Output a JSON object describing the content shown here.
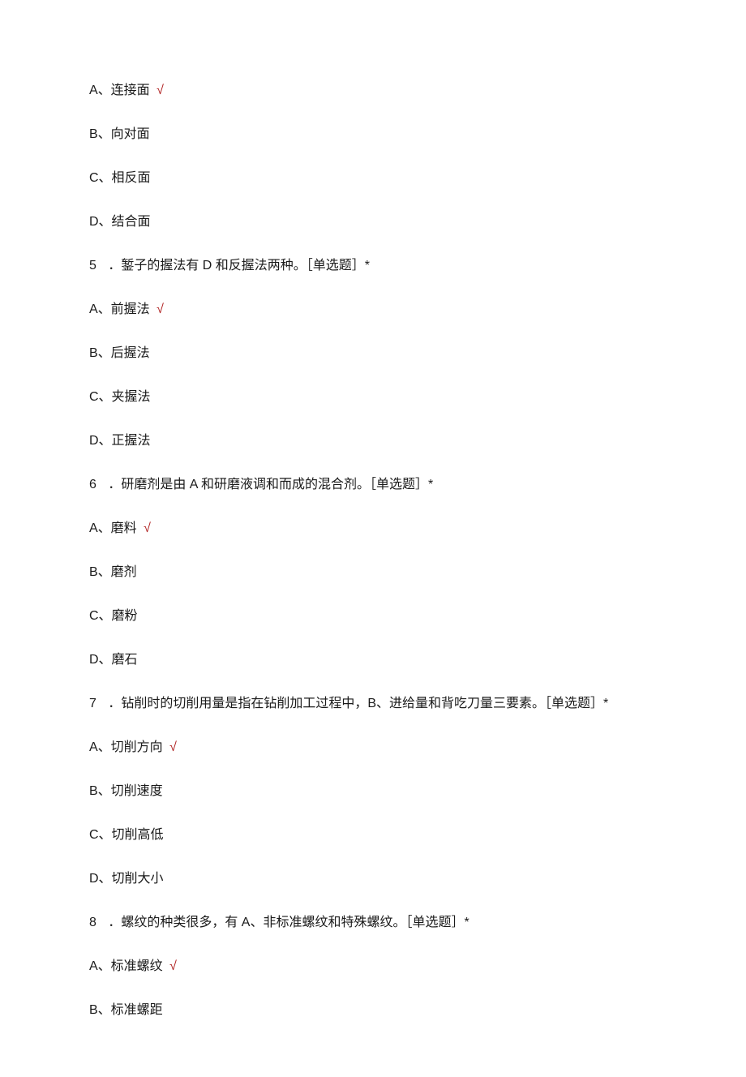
{
  "q4": {
    "a": {
      "label": "A、连接面",
      "correct": true
    },
    "b": {
      "label": "B、向对面"
    },
    "c": {
      "label": "C、相反面"
    },
    "d": {
      "label": "D、结合面"
    }
  },
  "q5": {
    "num": "5",
    "text": "．錾子的握法有 D 和反握法两种。［单选题］*",
    "a": {
      "label": "A、前握法",
      "correct": true
    },
    "b": {
      "label": "B、后握法"
    },
    "c": {
      "label": "C、夹握法"
    },
    "d": {
      "label": "D、正握法"
    }
  },
  "q6": {
    "num": "6",
    "text": "．研磨剂是由 A 和研磨液调和而成的混合剂。［单选题］*",
    "a": {
      "label": "A、磨料",
      "correct": true
    },
    "b": {
      "label": "B、磨剂"
    },
    "c": {
      "label": "C、磨粉"
    },
    "d": {
      "label": "D、磨石"
    }
  },
  "q7": {
    "num": "7",
    "text": "．钻削时的切削用量是指在钻削加工过程中，B、进给量和背吃刀量三要素。［单选题］*",
    "a": {
      "label": "A、切削方向",
      "correct": true
    },
    "b": {
      "label": "B、切削速度"
    },
    "c": {
      "label": "C、切削高低"
    },
    "d": {
      "label": "D、切削大小"
    }
  },
  "q8": {
    "num": "8",
    "text": "．螺纹的种类很多，有 A、非标准螺纹和特殊螺纹。［单选题］*",
    "a": {
      "label": "A、标准螺纹",
      "correct": true
    },
    "b": {
      "label": "B、标准螺距"
    }
  },
  "checkmark": "√"
}
